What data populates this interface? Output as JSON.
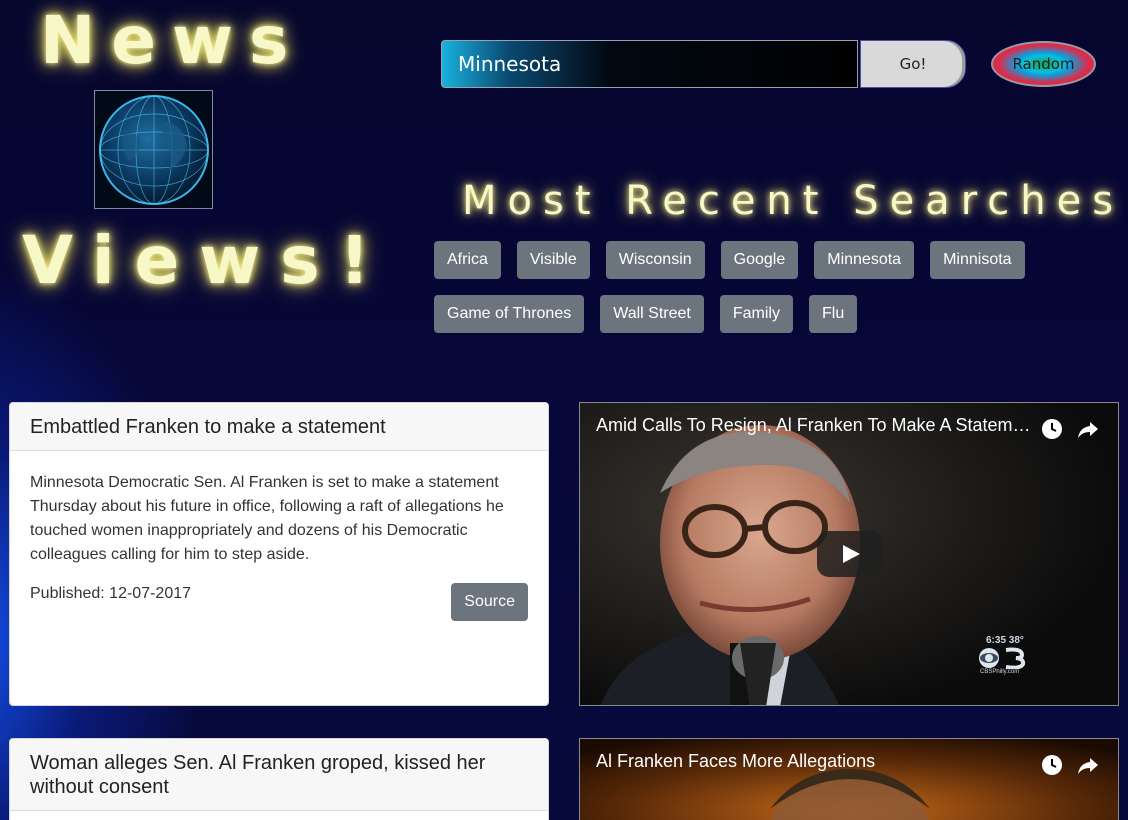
{
  "logo": {
    "line1": "News",
    "line2": "Views!"
  },
  "search": {
    "value": "Minnesota",
    "go_label": "Go!",
    "random_label": "Random"
  },
  "recent": {
    "title": "Most Recent Searches",
    "items": [
      "Africa",
      "Visible",
      "Wisconsin",
      "Google",
      "Minnesota",
      "Minnisota",
      "Game of Thrones",
      "Wall Street",
      "Family",
      "Flu"
    ]
  },
  "articles": [
    {
      "title": "Embattled Franken to make a statement",
      "description": "Minnesota Democratic Sen. Al Franken is set to make a statement Thursday about his future in office, following a raft of allegations he touched women inappropriately and dozens of his Democratic colleagues calling for him to step aside.",
      "published": "Published: 12-07-2017",
      "source_label": "Source"
    },
    {
      "title": "Woman alleges Sen. Al Franken groped, kissed her without consent"
    }
  ],
  "videos": [
    {
      "title": "Amid Calls To Resign, Al Franken To Make A Statement",
      "bug_time": "6:35 38°",
      "bug_site": "CBSPhilly.com"
    },
    {
      "title": "Al Franken Faces More Allegations"
    }
  ],
  "icons": {
    "globe": "globe-icon",
    "clock": "clock-icon",
    "share": "share-icon",
    "play": "play-icon"
  },
  "colors": {
    "background": "#07073a",
    "glow_text": "#f7f7c8",
    "chip": "#6c757d",
    "accent_blue": "#1a5cff"
  }
}
